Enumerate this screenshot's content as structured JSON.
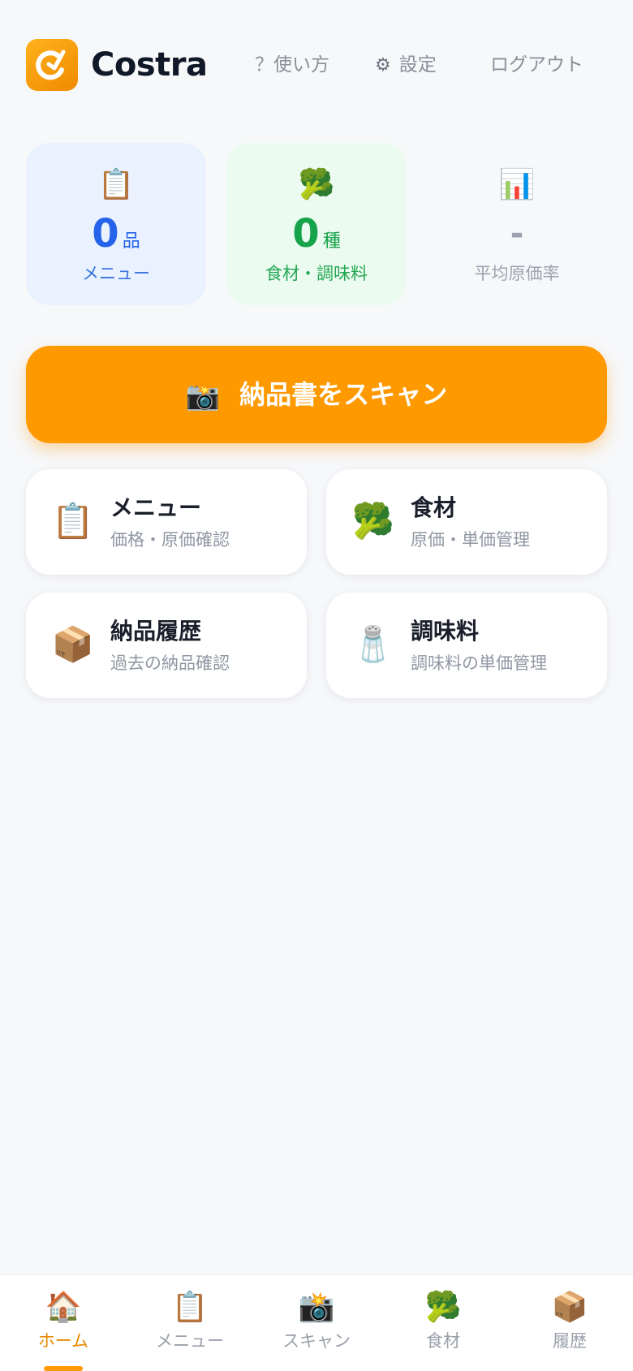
{
  "header": {
    "app_name": "Costra",
    "help_label": "？使い方",
    "settings_label": "設定",
    "logout_label": "ログアウト"
  },
  "stats": [
    {
      "icon": "📋",
      "icon_name": "clipboard-icon",
      "value": "0",
      "unit": "品",
      "label": "メニュー"
    },
    {
      "icon": "🥦",
      "icon_name": "broccoli-icon",
      "value": "0",
      "unit": "種",
      "label": "食材・調味料"
    },
    {
      "icon": "📊",
      "icon_name": "bar-chart-icon",
      "value": "-",
      "unit": "",
      "label": "平均原価率"
    }
  ],
  "scan_button": {
    "icon": "📸",
    "icon_name": "camera-flash-icon",
    "label": "納品書をスキャン"
  },
  "cards": [
    {
      "icon": "📋",
      "icon_name": "clipboard-icon",
      "title": "メニュー",
      "subtitle": "価格・原価確認"
    },
    {
      "icon": "🥦",
      "icon_name": "broccoli-icon",
      "title": "食材",
      "subtitle": "原価・単価管理"
    },
    {
      "icon": "📦",
      "icon_name": "package-icon",
      "title": "納品履歴",
      "subtitle": "過去の納品確認"
    },
    {
      "icon": "🧂",
      "icon_name": "salt-shaker-icon",
      "title": "調味料",
      "subtitle": "調味料の単価管理"
    }
  ],
  "bottom_nav": [
    {
      "icon": "🏠",
      "icon_name": "home-icon",
      "label": "ホーム",
      "active": true
    },
    {
      "icon": "📋",
      "icon_name": "clipboard-icon",
      "label": "メニュー",
      "active": false
    },
    {
      "icon": "📸",
      "icon_name": "camera-flash-icon",
      "label": "スキャン",
      "active": false
    },
    {
      "icon": "🥦",
      "icon_name": "broccoli-icon",
      "label": "食材",
      "active": false
    },
    {
      "icon": "📦",
      "icon_name": "package-icon",
      "label": "履歴",
      "active": false
    }
  ],
  "colors": {
    "accent": "#ff9900",
    "menu_blue": "#2563eb",
    "ingredient_green": "#16a34a",
    "muted": "#9ca3af",
    "background": "#f7f8fa"
  }
}
